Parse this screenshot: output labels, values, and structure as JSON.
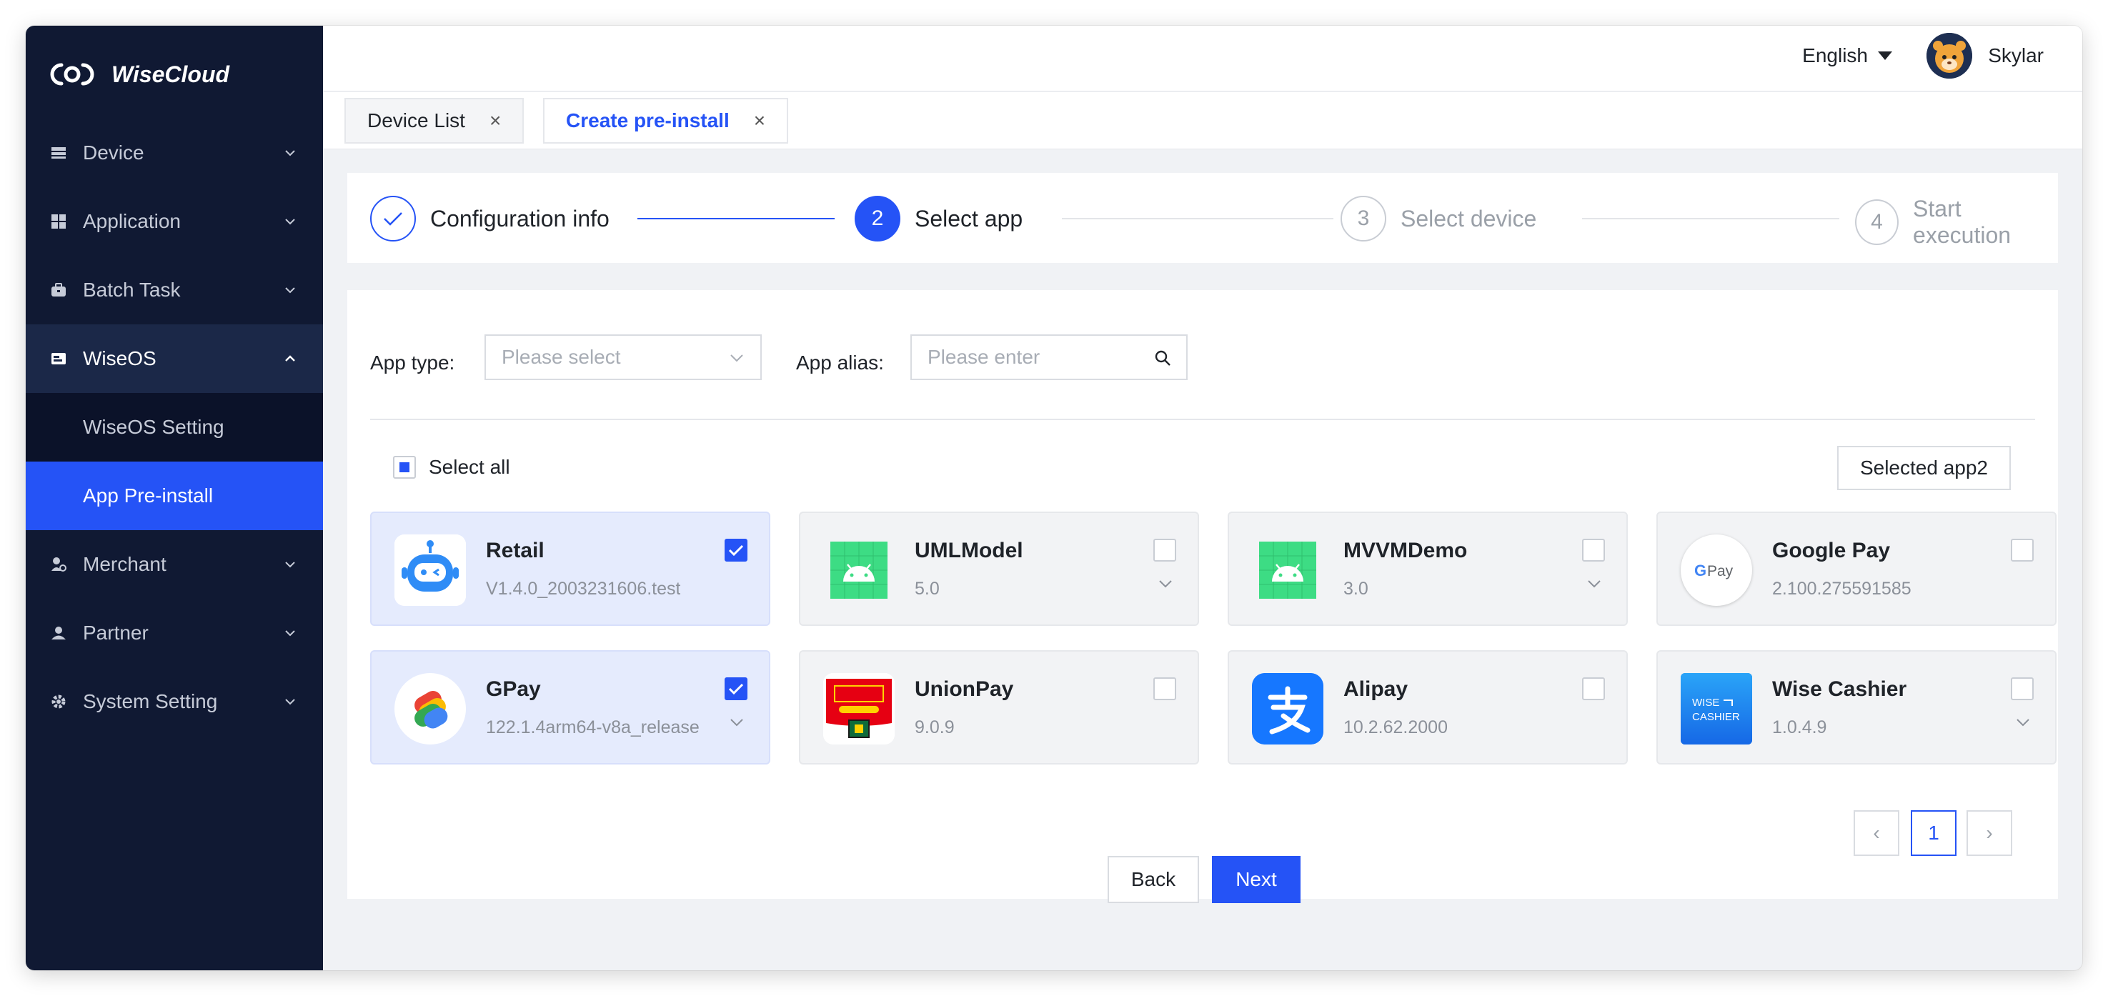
{
  "app": {
    "name": "WiseCloud"
  },
  "sidebar": {
    "items": [
      {
        "label": "Device",
        "icon": "device-icon"
      },
      {
        "label": "Application",
        "icon": "grid-icon"
      },
      {
        "label": "Batch Task",
        "icon": "briefcase-icon"
      },
      {
        "label": "WiseOS",
        "icon": "wiseos-icon",
        "expanded": true,
        "children": [
          {
            "label": "WiseOS Setting"
          },
          {
            "label": "App Pre-install",
            "active": true
          }
        ]
      },
      {
        "label": "Merchant",
        "icon": "merchant-icon"
      },
      {
        "label": "Partner",
        "icon": "partner-icon"
      },
      {
        "label": "System Setting",
        "icon": "gear-icon"
      }
    ]
  },
  "header": {
    "language": "English",
    "user_name": "Skylar"
  },
  "tabs": [
    {
      "label": "Device List",
      "close": "×"
    },
    {
      "label": "Create pre-install",
      "close": "×",
      "active": true
    }
  ],
  "steps": [
    {
      "label": "Configuration info",
      "number": "1",
      "status": "done"
    },
    {
      "label": "Select app",
      "number": "2",
      "status": "current"
    },
    {
      "label": "Select device",
      "number": "3",
      "status": "wait"
    },
    {
      "label": "Start execution",
      "number": "4",
      "status": "wait"
    }
  ],
  "filters": {
    "app_type_label": "App type:",
    "app_type_placeholder": "Please select",
    "app_alias_label": "App alias:",
    "app_alias_placeholder": "Please enter"
  },
  "select_all_label": "Select all",
  "selected_button": "Selected app2",
  "apps": [
    {
      "name": "Retail",
      "version": "V1.4.0_2003231606.test",
      "checked": true,
      "icon": "retail-robot-icon"
    },
    {
      "name": "UMLModel",
      "version": "5.0",
      "checked": false,
      "icon": "android-icon"
    },
    {
      "name": "MVVMDemo",
      "version": "3.0",
      "checked": false,
      "icon": "android-icon"
    },
    {
      "name": "Google Pay",
      "version": "2.100.275591585",
      "checked": false,
      "icon": "google-pay-icon"
    },
    {
      "name": "GPay",
      "version": "122.1.4arm64-v8a_release",
      "checked": true,
      "icon": "gpay-icon"
    },
    {
      "name": "UnionPay",
      "version": "9.0.9",
      "checked": false,
      "icon": "unionpay-icon"
    },
    {
      "name": "Alipay",
      "version": "10.2.62.2000",
      "checked": false,
      "icon": "alipay-icon"
    },
    {
      "name": "Wise Cashier",
      "version": "1.0.4.9",
      "checked": false,
      "icon": "wise-cashier-icon"
    }
  ],
  "pagination": {
    "prev": "‹",
    "current": "1",
    "next": "›"
  },
  "buttons": {
    "back": "Back",
    "next": "Next"
  },
  "colors": {
    "primary": "#2553f6",
    "sidebar": "#101933",
    "selected_card": "#e5ebfd"
  }
}
